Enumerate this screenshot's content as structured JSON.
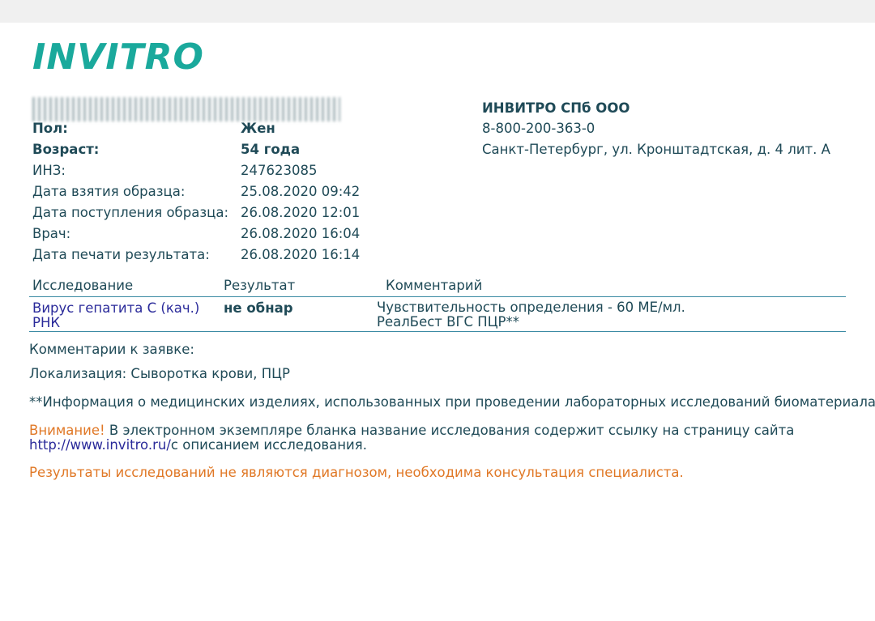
{
  "logo": "INVITRO",
  "patient": {
    "sex_label": "Пол:",
    "sex_value": "Жен",
    "age_label": "Возраст:",
    "age_value": "54 года",
    "inz_label": "ИНЗ:",
    "inz_value": "247623085",
    "sample_date_label": "Дата взятия образца:",
    "sample_date_value": "25.08.2020 09:42",
    "receipt_date_label": "Дата поступления образца:",
    "receipt_date_value": "26.08.2020 12:01",
    "doctor_label": "Врач:",
    "doctor_value": "26.08.2020 16:04",
    "print_date_label": "Дата печати результата:",
    "print_date_value": "26.08.2020 16:14"
  },
  "lab": {
    "name": "ИНВИТРО СПб ООО",
    "phone": "8-800-200-363-0",
    "address": "Санкт-Петербург, ул. Кронштадтская, д. 4 лит. А"
  },
  "table": {
    "headers": [
      "Исследование",
      "Результат",
      "Комментарий"
    ],
    "rows": [
      {
        "test_line1": "Вирус гепатита С (кач.)",
        "test_line2": "РНК",
        "result": "не обнар",
        "comment_line1": "Чувствительность определения - 60 МЕ/мл.",
        "comment_line2": "РеалБест ВГС ПЦР**"
      }
    ]
  },
  "notes": {
    "order_comments": "Комментарии к заявке:",
    "localization": "Локализация: Сыворотка крови, ПЦР",
    "info": "**Информация о медицинских изделиях, использованных при проведении лабораторных исследований биоматериала",
    "attention_label": "Внимание!",
    "attention_text": " В электронном экземпляре бланка название исследования содержит ссылку на страницу сайта",
    "attention_link": "http://www.invitro.ru/",
    "attention_link_suffix": "с описанием исследования.",
    "disclaimer": "Результаты исследований не являются диагнозом, необходима консультация специалиста."
  },
  "colors": {
    "brand": "#1aa99c",
    "text": "#1f4a57",
    "link": "#2a2a9a",
    "warning": "#e07826",
    "rule": "#3a8aa3"
  }
}
